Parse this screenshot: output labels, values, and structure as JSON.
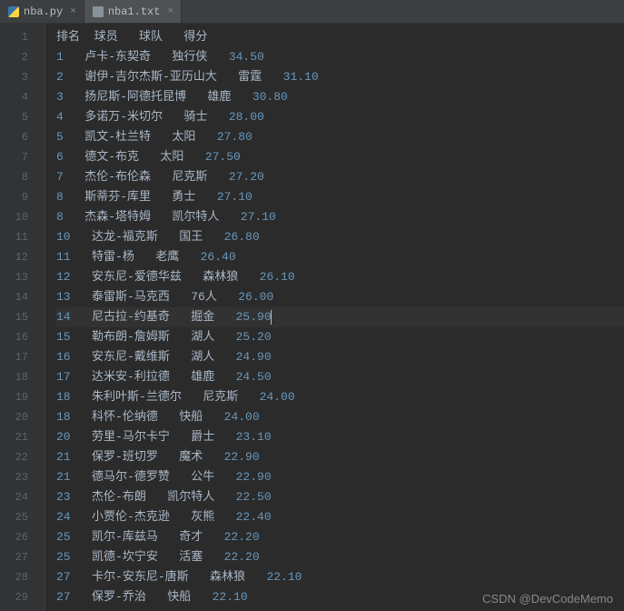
{
  "tabs": [
    {
      "label": "nba.py",
      "icon": "python-file-icon",
      "active": false
    },
    {
      "label": "nba1.txt",
      "icon": "text-file-icon",
      "active": true
    }
  ],
  "current_line": 15,
  "lines": [
    {
      "n": 1,
      "text": "排名  球员   球队   得分"
    },
    {
      "n": 2,
      "rank": "1",
      "player": "卢卡-东契奇",
      "team": "独行侠",
      "score": "34.50"
    },
    {
      "n": 3,
      "rank": "2",
      "player": "谢伊-吉尔杰斯-亚历山大",
      "team": "雷霆",
      "score": "31.10"
    },
    {
      "n": 4,
      "rank": "3",
      "player": "扬尼斯-阿德托昆博",
      "team": "雄鹿",
      "score": "30.80"
    },
    {
      "n": 5,
      "rank": "4",
      "player": "多诺万-米切尔",
      "team": "骑士",
      "score": "28.00"
    },
    {
      "n": 6,
      "rank": "5",
      "player": "凯文-杜兰特",
      "team": "太阳",
      "score": "27.80"
    },
    {
      "n": 7,
      "rank": "6",
      "player": "德文-布克",
      "team": "太阳",
      "score": "27.50"
    },
    {
      "n": 8,
      "rank": "7",
      "player": "杰伦-布伦森",
      "team": "尼克斯",
      "score": "27.20"
    },
    {
      "n": 9,
      "rank": "8",
      "player": "斯蒂芬-库里",
      "team": "勇士",
      "score": "27.10"
    },
    {
      "n": 10,
      "rank": "8",
      "player": "杰森-塔特姆",
      "team": "凯尔特人",
      "score": "27.10"
    },
    {
      "n": 11,
      "rank": "10",
      "player": "达龙-福克斯",
      "team": "国王",
      "score": "26.80"
    },
    {
      "n": 12,
      "rank": "11",
      "player": "特雷-杨",
      "team": "老鹰",
      "score": "26.40"
    },
    {
      "n": 13,
      "rank": "12",
      "player": "安东尼-爱德华兹",
      "team": "森林狼",
      "score": "26.10"
    },
    {
      "n": 14,
      "rank": "13",
      "player": "泰雷斯-马克西",
      "team": "76人",
      "score": "26.00"
    },
    {
      "n": 15,
      "rank": "14",
      "player": "尼古拉-约基奇",
      "team": "掘金",
      "score": "25.90"
    },
    {
      "n": 16,
      "rank": "15",
      "player": "勒布朗-詹姆斯",
      "team": "湖人",
      "score": "25.20"
    },
    {
      "n": 17,
      "rank": "16",
      "player": "安东尼-戴维斯",
      "team": "湖人",
      "score": "24.90"
    },
    {
      "n": 18,
      "rank": "17",
      "player": "达米安-利拉德",
      "team": "雄鹿",
      "score": "24.50"
    },
    {
      "n": 19,
      "rank": "18",
      "player": "朱利叶斯-兰德尔",
      "team": "尼克斯",
      "score": "24.00"
    },
    {
      "n": 20,
      "rank": "18",
      "player": "科怀-伦纳德",
      "team": "快船",
      "score": "24.00"
    },
    {
      "n": 21,
      "rank": "20",
      "player": "劳里-马尔卡宁",
      "team": "爵士",
      "score": "23.10"
    },
    {
      "n": 22,
      "rank": "21",
      "player": "保罗-班切罗",
      "team": "魔术",
      "score": "22.90"
    },
    {
      "n": 23,
      "rank": "21",
      "player": "德马尔-德罗赞",
      "team": "公牛",
      "score": "22.90"
    },
    {
      "n": 24,
      "rank": "23",
      "player": "杰伦-布朗",
      "team": "凯尔特人",
      "score": "22.50"
    },
    {
      "n": 25,
      "rank": "24",
      "player": "小贾伦-杰克逊",
      "team": "灰熊",
      "score": "22.40"
    },
    {
      "n": 26,
      "rank": "25",
      "player": "凯尔-库兹马",
      "team": "奇才",
      "score": "22.20"
    },
    {
      "n": 27,
      "rank": "25",
      "player": "凯德-坎宁安",
      "team": "活塞",
      "score": "22.20"
    },
    {
      "n": 28,
      "rank": "27",
      "player": "卡尔-安东尼-唐斯",
      "team": "森林狼",
      "score": "22.10"
    },
    {
      "n": 29,
      "rank": "27",
      "player": "保罗-乔治",
      "team": "快船",
      "score": "22.10"
    }
  ],
  "watermark": "CSDN @DevCodeMemo",
  "close_glyph": "×"
}
